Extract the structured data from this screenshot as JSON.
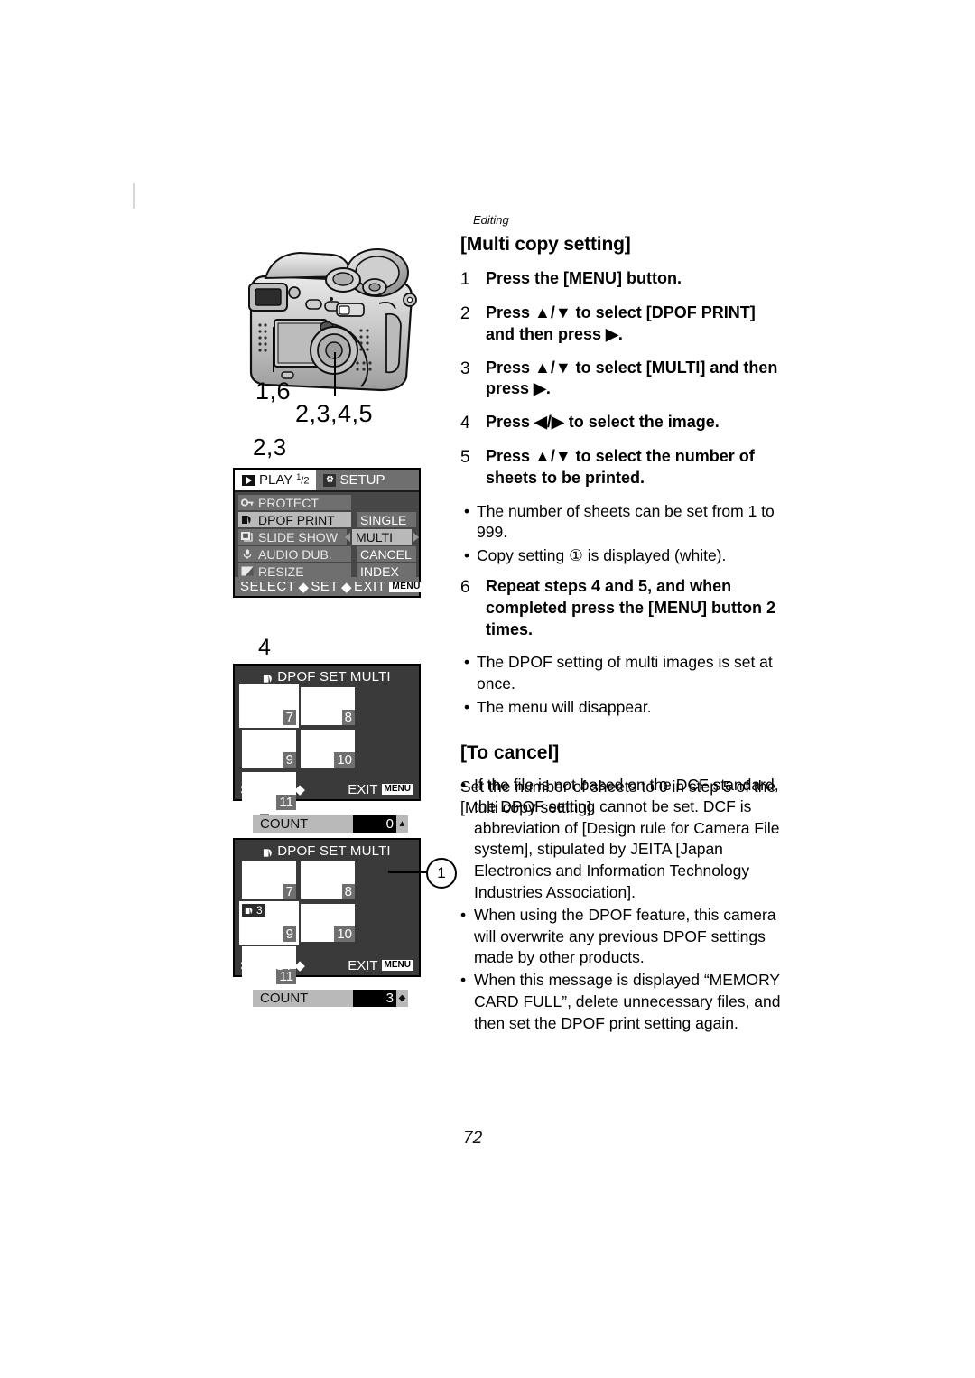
{
  "header": {
    "running_head": "Editing"
  },
  "page_number": "72",
  "section": {
    "title": "[Multi copy setting]",
    "steps": [
      {
        "num": "1",
        "text": "Press the [MENU] button."
      },
      {
        "num": "2",
        "text": "Press ▲/▼ to select [DPOF PRINT] and then press ▶."
      },
      {
        "num": "3",
        "text": "Press ▲/▼ to select [MULTI] and then press ▶."
      },
      {
        "num": "4",
        "text": "Press ◀/▶ to select the image."
      },
      {
        "num": "5",
        "text": "Press ▲/▼ to select the number of sheets to be printed."
      }
    ],
    "bullets_after_5": [
      "The number of sheets can be set from 1 to 999.",
      "Copy setting ① is displayed (white)."
    ],
    "step6": {
      "num": "6",
      "text": "Repeat steps 4 and 5, and when completed press the [MENU] button 2 times."
    },
    "bullets_after_6": [
      "The DPOF setting of multi images is set at once.",
      "The menu will disappear."
    ]
  },
  "cancel": {
    "title": "[To cancel]",
    "body": "Set the number of sheets to 0 in step 5 of the [Multi copy setting]."
  },
  "notes": [
    "If the file is not based on the DCF standard, the DPOF setting cannot be set. DCF is abbreviation of [Design rule for Camera File system], stipulated by JEITA [Japan Electronics and Information Technology Industries Association].",
    "When using the DPOF feature, this camera will overwrite any previous DPOF settings made by other products.",
    "When this message is displayed “MEMORY CARD FULL”, delete unnecessary files, and then set the DPOF print setting again."
  ],
  "figure_labels": {
    "shutter_label": "1,6",
    "cursor_label": "2,3,4,5",
    "menu_label": "2,3",
    "step4_label": "4",
    "step5_label": "5",
    "callout_1": "1"
  },
  "menu_screen": {
    "tabs": [
      {
        "label": "PLAY",
        "fraction_top": "1",
        "fraction_bottom": "2",
        "icon": "play-icon",
        "active": true
      },
      {
        "label": "SETUP",
        "icon": "wrench-icon",
        "active": false
      }
    ],
    "items": [
      {
        "label": "PROTECT",
        "icon": "key-icon",
        "selected": false
      },
      {
        "label": "DPOF PRINT",
        "icon": "dpof-icon",
        "selected": true
      },
      {
        "label": "SLIDE SHOW",
        "icon": "slideshow-icon",
        "selected": false
      },
      {
        "label": "AUDIO DUB.",
        "icon": "microphone-icon",
        "selected": false
      },
      {
        "label": "RESIZE",
        "icon": "resize-icon",
        "selected": false
      }
    ],
    "options": [
      {
        "label": "SINGLE",
        "selected": false
      },
      {
        "label": "MULTI",
        "selected": true
      },
      {
        "label": "CANCEL",
        "selected": false
      },
      {
        "label": "INDEX",
        "selected": false
      }
    ],
    "footer": {
      "select": "SELECT",
      "set": "SET",
      "exit": "EXIT",
      "menu_button": "MENU"
    }
  },
  "dpof_screen_step4": {
    "title": "DPOF SET MULTI",
    "thumbnails": [
      {
        "number": "7",
        "selected": true,
        "badge": null
      },
      {
        "number": "8",
        "selected": false,
        "badge": null
      },
      {
        "number": "9",
        "selected": false,
        "badge": null
      },
      {
        "number": "10",
        "selected": false,
        "badge": null
      },
      {
        "number": "11",
        "selected": false,
        "badge": null
      }
    ],
    "count_label": "COUNT",
    "count_value": "0",
    "count_arrows": "▲",
    "footer": {
      "select": "SELECT",
      "exit": "EXIT",
      "menu_button": "MENU"
    }
  },
  "dpof_screen_step5": {
    "title": "DPOF SET MULTI",
    "thumbnails": [
      {
        "number": "7",
        "selected": false,
        "badge": null
      },
      {
        "number": "8",
        "selected": false,
        "badge": null
      },
      {
        "number": "9",
        "selected": true,
        "badge": "3"
      },
      {
        "number": "10",
        "selected": false,
        "badge": null
      },
      {
        "number": "11",
        "selected": false,
        "badge": null
      }
    ],
    "count_label": "COUNT",
    "count_value": "3",
    "count_arrows": "▲▼",
    "footer": {
      "select": "SELECT",
      "exit": "EXIT",
      "menu_button": "MENU"
    }
  }
}
